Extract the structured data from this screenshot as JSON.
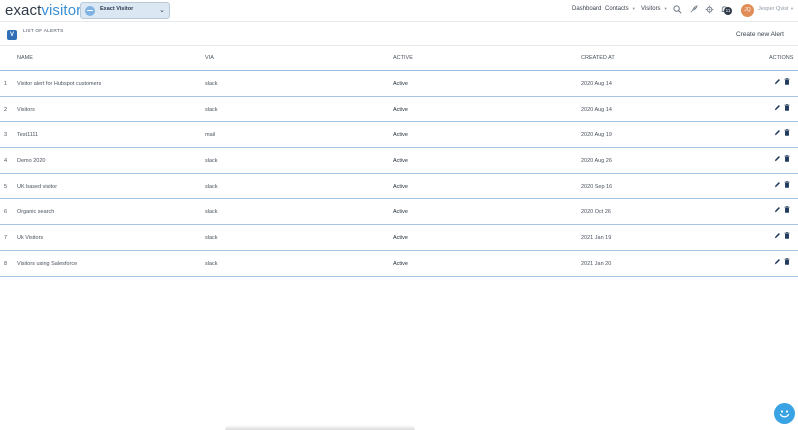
{
  "brand": {
    "name_dark": "exact",
    "name_accent": "visitor"
  },
  "site_select": {
    "value": "Exact Visitor"
  },
  "nav": {
    "dashboard": "Dashboard",
    "contacts": "Contacts",
    "visitors": "Visitors"
  },
  "notifications": {
    "count": "11"
  },
  "user": {
    "name": "Jesper Qvist",
    "initials": "JQ"
  },
  "page": {
    "title": "LIST OF ALERTS",
    "create_label": "Create new Alert"
  },
  "table": {
    "headers": {
      "name": "NAME",
      "via": "VIA",
      "active": "ACTIVE",
      "created": "CREATED AT",
      "actions": "ACTIONS"
    },
    "rows": [
      {
        "num": "1",
        "name": "Visitor alert for Hubspot customers",
        "via": "slack",
        "active": "Active",
        "created": "2020 Aug 14"
      },
      {
        "num": "2",
        "name": "Visitors",
        "via": "slack",
        "active": "Active",
        "created": "2020 Aug 14"
      },
      {
        "num": "3",
        "name": "Test1111",
        "via": "mail",
        "active": "Active",
        "created": "2020 Aug 19"
      },
      {
        "num": "4",
        "name": "Demo 2020",
        "via": "slack",
        "active": "Active",
        "created": "2020 Aug 26"
      },
      {
        "num": "5",
        "name": "UK based visitor",
        "via": "slack",
        "active": "Active",
        "created": "2020 Sep 16"
      },
      {
        "num": "6",
        "name": "Organic search",
        "via": "slack",
        "active": "Active",
        "created": "2020 Oct 26"
      },
      {
        "num": "7",
        "name": "Uk Visitors",
        "via": "slack",
        "active": "Active",
        "created": "2021 Jan 19"
      },
      {
        "num": "8",
        "name": "Visitors using Salesforce",
        "via": "slack",
        "active": "Active",
        "created": "2021 Jan 20"
      }
    ]
  },
  "icons": {
    "edit": "pencil-icon",
    "delete": "trash-icon",
    "search": "search-icon",
    "rocket": "rocket-icon",
    "settings": "gear-icon",
    "bell": "bell-icon",
    "chat": "chat-icon"
  },
  "colors": {
    "accent": "#2f6fb7",
    "row_border": "#a6c6e6",
    "chat": "#3aa3e3",
    "avatar": "#e08d58"
  }
}
